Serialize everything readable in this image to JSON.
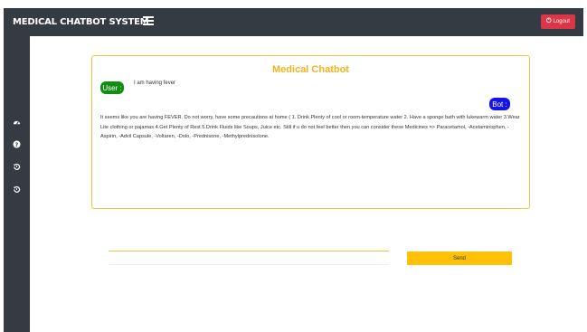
{
  "header": {
    "brand": "MEDICAL CHATBOT SYSTEM",
    "menu_icon": "hamburger-menu-icon",
    "logout_label": "Logout",
    "logout_icon": "power-icon",
    "logout_color": "#dc3545",
    "bar_color": "#353b42"
  },
  "sidebar": {
    "icons": [
      "dashboard-gauge-icon",
      "help-question-icon",
      "history-icon",
      "history-icon"
    ]
  },
  "chat": {
    "title": "Medical Chatbot",
    "title_color": "#f0b322",
    "user_label": "User :",
    "user_color": "#138c13",
    "user_message": "I am having fever",
    "bot_label": "Bot :",
    "bot_color": "#1414e8",
    "bot_message": "It seems like you are having FEVER. Do not worry, have some precautions at home ( 1. Drink Plenty of cool or room-temperature water 2. Have a sponge bath with lukewarm water 3.Wear Lite clothing or pajamas 4.Get Plenty of Rest 5.Drink Fluids like Soups, Juice etc. Still if u do not feel better then you can consider these Medicines => Paracetamol, -Acetaminophen, -Aspirin, -Advil Capsule, -Voltaren, -Dolo, -Prednisone, -Methylprednisolone."
  },
  "composer": {
    "input_value": "",
    "send_label": "Send",
    "send_color": "#ffc107"
  }
}
